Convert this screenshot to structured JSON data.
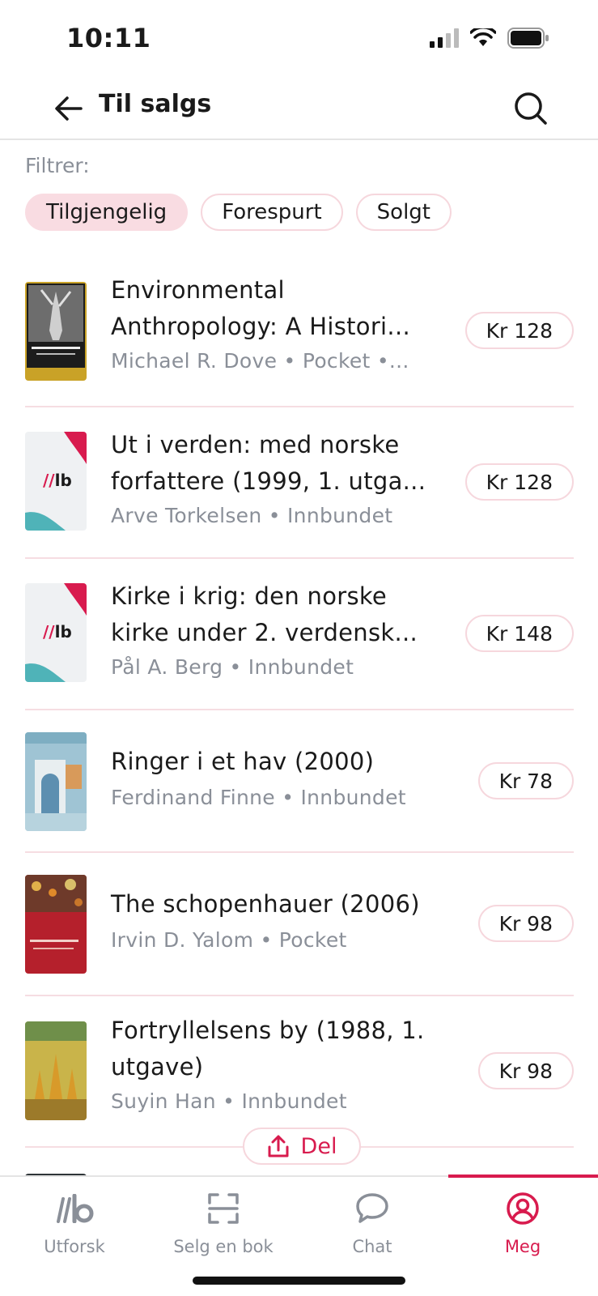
{
  "status_bar": {
    "time": "10:11"
  },
  "header": {
    "title": "Til salgs",
    "back_icon": "arrow-left-icon",
    "search_icon": "search-icon"
  },
  "filters": {
    "label": "Filtrer:",
    "chips": [
      {
        "label": "Tilgjengelig",
        "active": true
      },
      {
        "label": "Forespurt",
        "active": false
      },
      {
        "label": "Solgt",
        "active": false
      }
    ]
  },
  "books": [
    {
      "title_line1": "Environmental",
      "title_line2": "Anthropology: A Histori...",
      "meta": "Michael R. Dove • Pocket •...",
      "price": "Kr 128",
      "cover": "environmental-anthropology"
    },
    {
      "title_line1": "Ut i verden: med norske",
      "title_line2": "forfattere (1999, 1. utga...",
      "meta": "Arve Torkelsen • Innbundet",
      "price": "Kr 128",
      "cover": "placeholder"
    },
    {
      "title_line1": "Kirke i krig: den norske",
      "title_line2": "kirke under 2. verdensk...",
      "meta": "Pål A. Berg • Innbundet",
      "price": "Kr 148",
      "cover": "placeholder"
    },
    {
      "title_line1": "Ringer i et hav (2000)",
      "meta": "Ferdinand Finne • Innbundet",
      "price": "Kr 78",
      "cover": "ringer-i-et-hav"
    },
    {
      "title_line1": "The schopenhauer (2006)",
      "meta": "Irvin D. Yalom • Pocket",
      "price": "Kr 98",
      "cover": "schopenhauer"
    },
    {
      "title_line1": "Fortryllelsens by (1988, 1.",
      "title_line2": "utgave)",
      "meta": "Suyin Han • Innbundet",
      "price": "Kr 98",
      "cover": "fortryllelsens-by"
    }
  ],
  "placeholder_logo": "lb",
  "share": {
    "label": "Del",
    "icon": "share-icon"
  },
  "bottom_nav": [
    {
      "label": "Utforsk",
      "icon": "lb-logo-icon",
      "active": false
    },
    {
      "label": "Selg en bok",
      "icon": "scan-icon",
      "active": false
    },
    {
      "label": "Chat",
      "icon": "chat-bubble-icon",
      "active": false
    },
    {
      "label": "Meg",
      "icon": "user-circle-icon",
      "active": true
    }
  ],
  "colors": {
    "accent": "#d81b4e",
    "chip_active_bg": "#f9dce2",
    "muted_text": "#8a8f98"
  }
}
